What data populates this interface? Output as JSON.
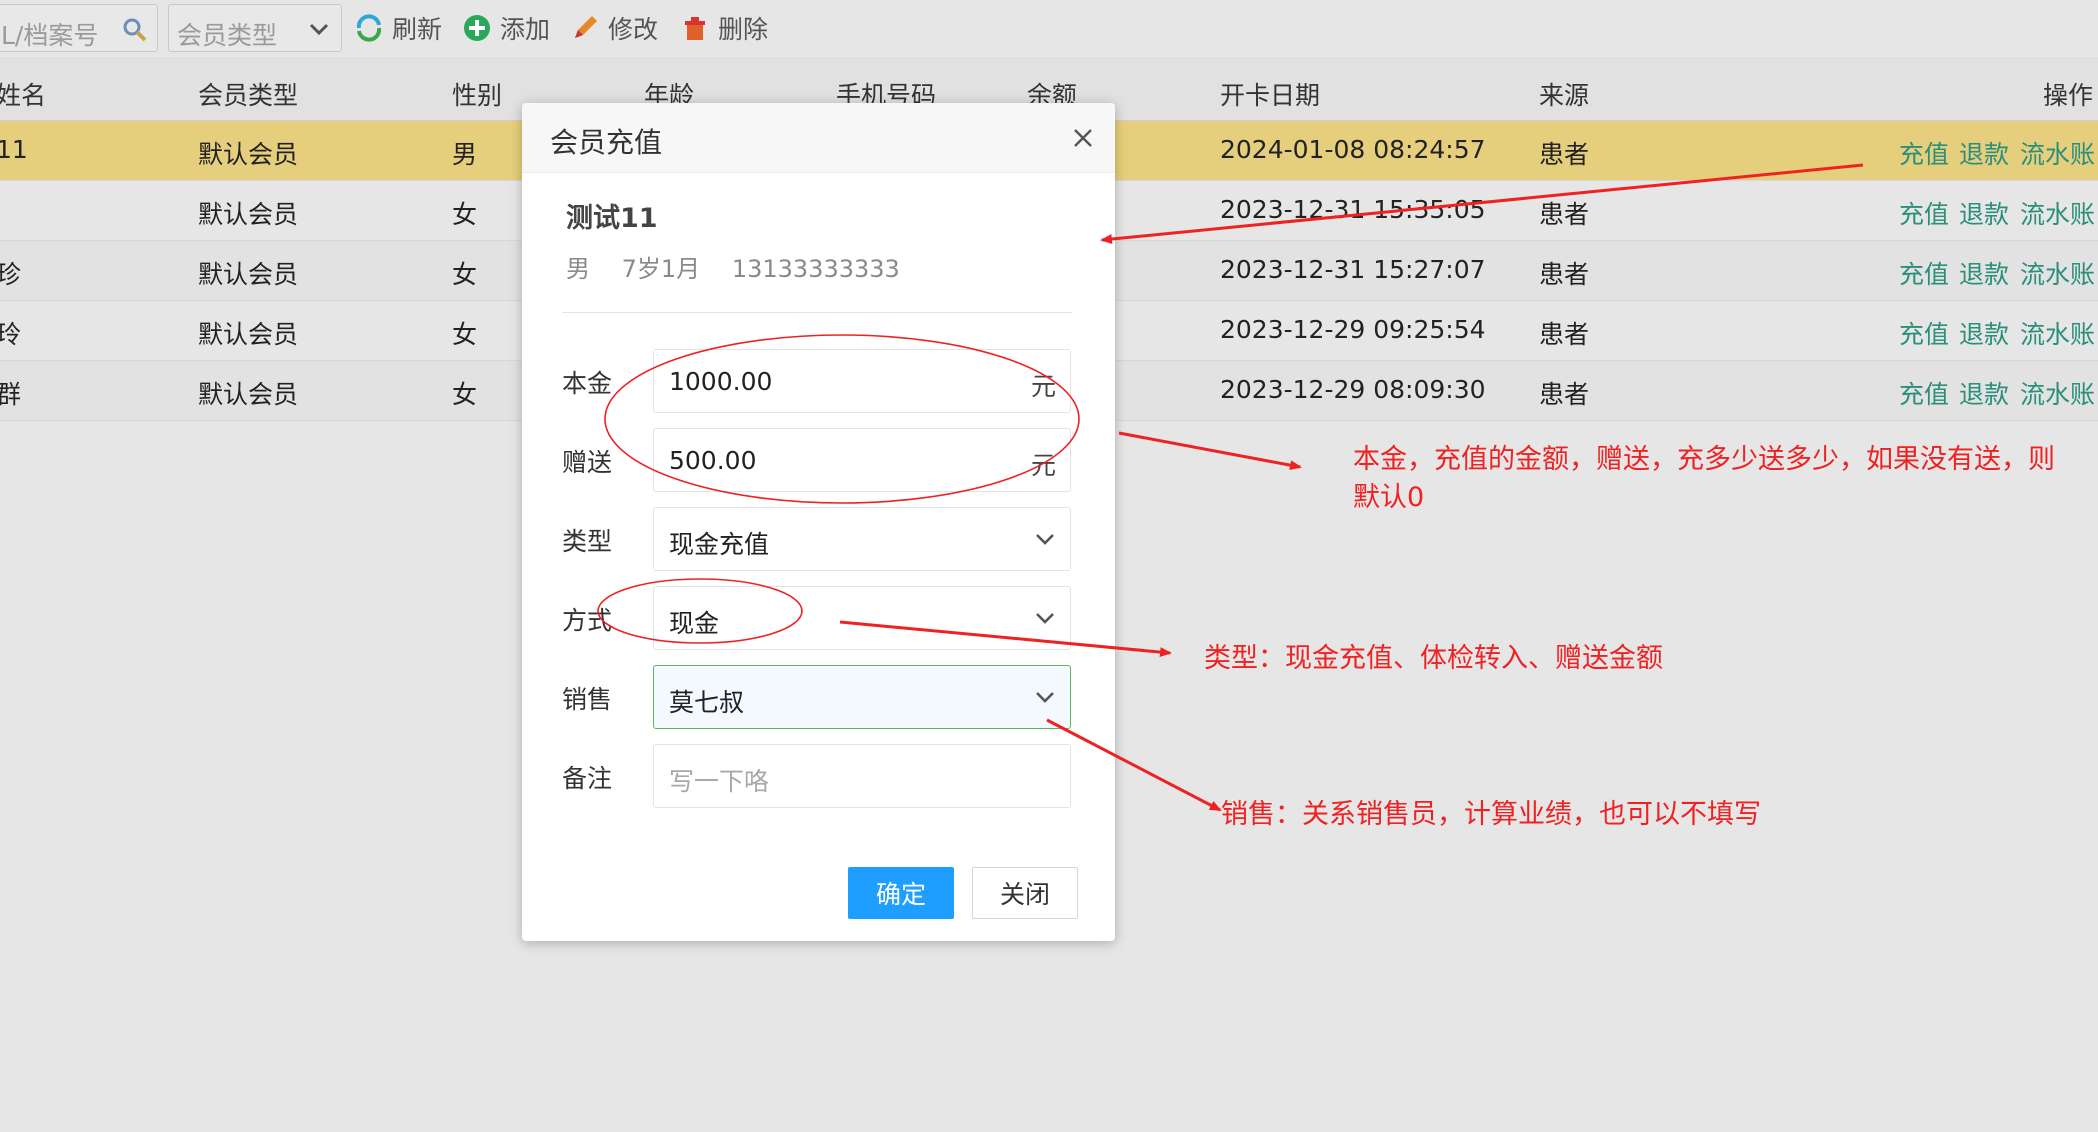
{
  "toolbar": {
    "search_placeholder": "L/档案号",
    "member_type_placeholder": "会员类型",
    "refresh": "刷新",
    "add": "添加",
    "edit": "修改",
    "delete": "删除"
  },
  "table": {
    "headers": [
      "姓名",
      "会员类型",
      "性别",
      "年龄",
      "手机号码",
      "余额",
      "开卡日期",
      "来源",
      "操作"
    ],
    "rows": [
      {
        "name": "11",
        "type": "默认会员",
        "gender": "男",
        "date": "2024-01-08 08:24:57",
        "source": "患者"
      },
      {
        "name": "",
        "type": "默认会员",
        "gender": "女",
        "date": "2023-12-31 15:35:05",
        "source": "患者"
      },
      {
        "name": "珍",
        "type": "默认会员",
        "gender": "女",
        "date": "2023-12-31 15:27:07",
        "source": "患者"
      },
      {
        "name": "玲",
        "type": "默认会员",
        "gender": "女",
        "date": "2023-12-29 09:25:54",
        "source": "患者"
      },
      {
        "name": "群",
        "type": "默认会员",
        "gender": "女",
        "date": "2023-12-29 08:09:30",
        "source": "患者"
      }
    ],
    "actions": {
      "recharge": "充值",
      "refund": "退款",
      "ledger": "流水账"
    }
  },
  "dialog": {
    "title": "会员充值",
    "patient_name": "测试11",
    "patient_gender": "男",
    "patient_age": "7岁1月",
    "patient_phone": "13133333333",
    "principal_label": "本金",
    "principal_value": "1000.00",
    "gift_label": "赠送",
    "gift_value": "500.00",
    "unit": "元",
    "type_label": "类型",
    "type_value": "现金充值",
    "method_label": "方式",
    "method_value": "现金",
    "sales_label": "销售",
    "sales_value": "莫七叔",
    "remark_label": "备注",
    "remark_placeholder": "写一下咯",
    "ok": "确定",
    "close": "关闭"
  },
  "annotations": {
    "note1_line1": "本金，充值的金额，赠送，充多少送多少，如果没有送，则",
    "note1_line2": "默认0",
    "note2": "类型：现金充值、体检转入、赠送金额",
    "note3": "销售：关系销售员，计算业绩，也可以不填写"
  },
  "colors": {
    "selected_row": "#e6cf7c",
    "action_link": "#2a8f7b",
    "primary_button": "#1e9fff",
    "annotation_red": "#ee2222"
  }
}
